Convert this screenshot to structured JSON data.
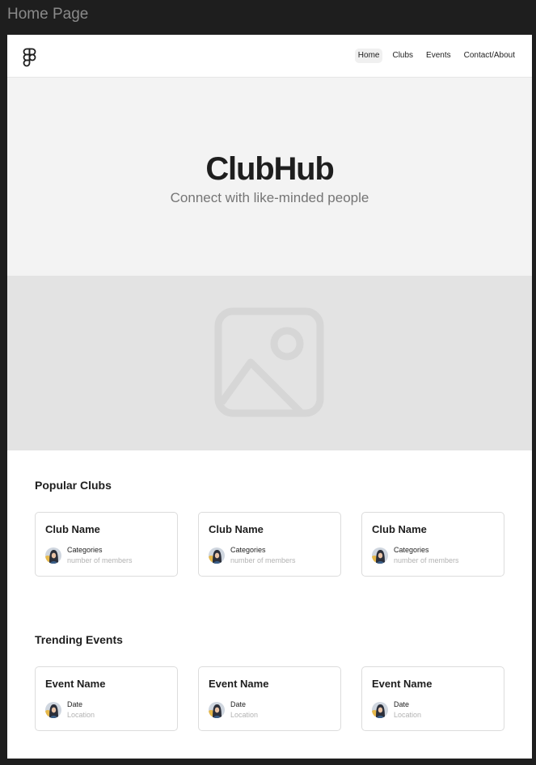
{
  "frame": {
    "title": "Home Page"
  },
  "nav": {
    "logo_icon": "figma-logo-icon",
    "links": [
      {
        "label": "Home",
        "active": true
      },
      {
        "label": "Clubs",
        "active": false
      },
      {
        "label": "Events",
        "active": false
      },
      {
        "label": "Contact/About",
        "active": false
      }
    ]
  },
  "hero": {
    "title": "ClubHub",
    "subtitle": "Connect with like-minded people"
  },
  "image_placeholder": {
    "icon": "image-placeholder-icon"
  },
  "popular_clubs": {
    "title": "Popular Clubs",
    "cards": [
      {
        "title": "Club Name",
        "primary": "Categories",
        "secondary": "number of members"
      },
      {
        "title": "Club Name",
        "primary": "Categories",
        "secondary": "number of members"
      },
      {
        "title": "Club Name",
        "primary": "Categories",
        "secondary": "number of members"
      }
    ]
  },
  "trending_events": {
    "title": "Trending Events",
    "cards": [
      {
        "title": "Event Name",
        "primary": "Date",
        "secondary": "Location"
      },
      {
        "title": "Event Name",
        "primary": "Date",
        "secondary": "Location"
      },
      {
        "title": "Event Name",
        "primary": "Date",
        "secondary": "Location"
      }
    ]
  },
  "colors": {
    "canvas": "#1e1e1e",
    "hero_bg": "#f3f3f3",
    "placeholder_bg": "#e3e3e3",
    "text": "#1e1e1e",
    "muted": "#757575"
  }
}
